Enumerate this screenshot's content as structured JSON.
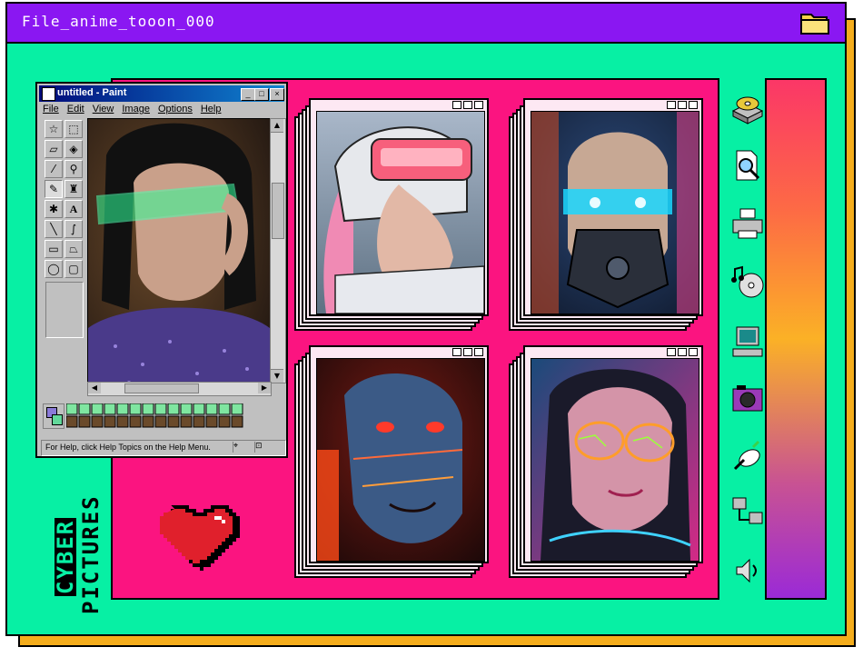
{
  "window": {
    "title": "File_anime_tooon_000",
    "folder_icon": "folder-icon"
  },
  "paint": {
    "title": "untitled - Paint",
    "menu": [
      "File",
      "Edit",
      "View",
      "Image",
      "Options",
      "Help"
    ],
    "minimize": "_",
    "maximize": "□",
    "close": "×",
    "status": "For Help, click Help Topics on the Help Menu."
  },
  "label": {
    "line1": "CYBER",
    "line2": "PICTURES"
  },
  "gallery": [
    {
      "name": "helmet-visor-portrait"
    },
    {
      "name": "cyber-mask-portrait"
    },
    {
      "name": "red-cyborg-portrait"
    },
    {
      "name": "neon-glasses-portrait"
    }
  ],
  "desktop_icons": [
    "cd-drive-icon",
    "search-document-icon",
    "printer-icon",
    "music-cd-icon",
    "computer-icon",
    "camera-icon",
    "satellite-icon",
    "network-icon",
    "speaker-icon"
  ],
  "colors": {
    "window_bg": "#07f0a4",
    "titlebar": "#8a17f2",
    "panel": "#fb1480",
    "shadow": "#f4ad1c"
  }
}
